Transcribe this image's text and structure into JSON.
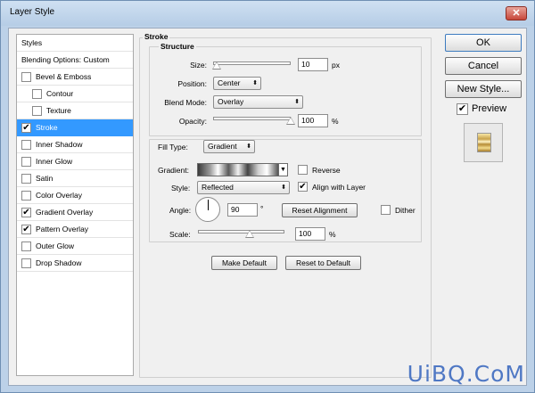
{
  "window": {
    "title": "Layer Style",
    "close": "✕"
  },
  "styles_panel": {
    "header": "Styles",
    "blending": "Blending Options: Custom",
    "items": [
      {
        "label": "Bevel & Emboss",
        "checked": false
      },
      {
        "label": "Contour",
        "checked": false
      },
      {
        "label": "Texture",
        "checked": false
      },
      {
        "label": "Stroke",
        "checked": true
      },
      {
        "label": "Inner Shadow",
        "checked": false
      },
      {
        "label": "Inner Glow",
        "checked": false
      },
      {
        "label": "Satin",
        "checked": false
      },
      {
        "label": "Color Overlay",
        "checked": false
      },
      {
        "label": "Gradient Overlay",
        "checked": true
      },
      {
        "label": "Pattern Overlay",
        "checked": true
      },
      {
        "label": "Outer Glow",
        "checked": false
      },
      {
        "label": "Drop Shadow",
        "checked": false
      }
    ]
  },
  "stroke": {
    "title": "Stroke",
    "structure": "Structure",
    "size_label": "Size:",
    "size_value": "10",
    "size_unit": "px",
    "size_fraction": 0.05,
    "position_label": "Position:",
    "position_value": "Center",
    "blend_label": "Blend Mode:",
    "blend_value": "Overlay",
    "opacity_label": "Opacity:",
    "opacity_value": "100",
    "opacity_unit": "%",
    "opacity_fraction": 1.0
  },
  "fill": {
    "type_label": "Fill Type:",
    "type_value": "Gradient",
    "gradient_label": "Gradient:",
    "reverse_label": "Reverse",
    "reverse_checked": false,
    "style_label": "Style:",
    "style_value": "Reflected",
    "align_label": "Align with Layer",
    "align_checked": true,
    "angle_label": "Angle:",
    "angle_value": "90",
    "angle_unit": "°",
    "reset_alignment": "Reset Alignment",
    "dither_label": "Dither",
    "dither_checked": false,
    "scale_label": "Scale:",
    "scale_value": "100",
    "scale_unit": "%",
    "scale_fraction": 0.6
  },
  "buttons": {
    "make_default": "Make Default",
    "reset_default": "Reset to Default",
    "ok": "OK",
    "cancel": "Cancel",
    "new_style": "New Style...",
    "preview_label": "Preview",
    "preview_checked": true
  },
  "watermark": "UiBQ.CoM",
  "colors": {
    "selection": "#3399ff",
    "titlebar": "#bcd1e8",
    "close": "#c7463a"
  }
}
